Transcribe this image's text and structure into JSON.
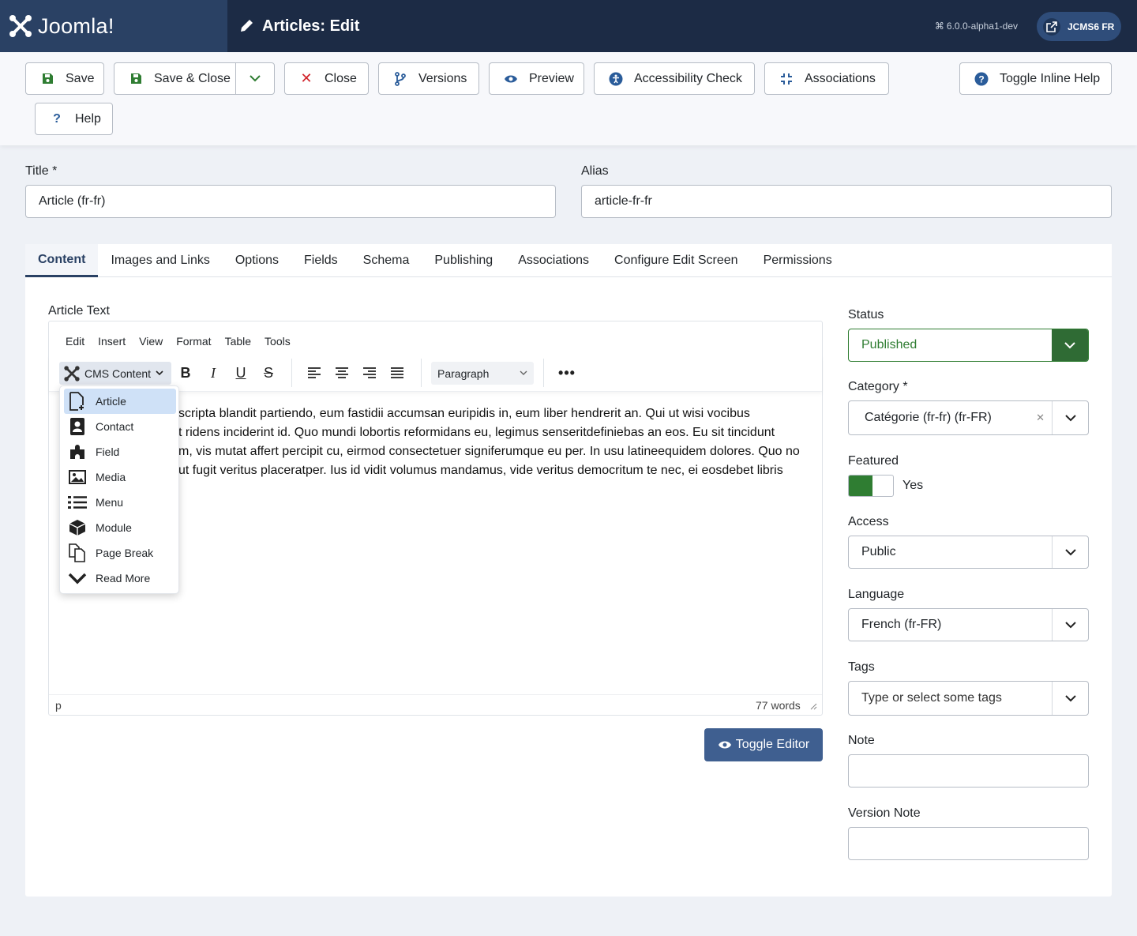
{
  "header": {
    "logo_text": "Joomla!",
    "page_title": "Articles: Edit",
    "version": "6.0.0-alpha1-dev",
    "site_button": "JCMS6 FR"
  },
  "toolbar": {
    "save": "Save",
    "save_close": "Save & Close",
    "close": "Close",
    "versions": "Versions",
    "preview": "Preview",
    "accessibility": "Accessibility Check",
    "associations": "Associations",
    "toggle_help": "Toggle Inline Help",
    "help": "Help"
  },
  "form": {
    "title_label": "Title *",
    "title_value": "Article (fr-fr)",
    "alias_label": "Alias",
    "alias_value": "article-fr-fr"
  },
  "tabs": [
    "Content",
    "Images and Links",
    "Options",
    "Fields",
    "Schema",
    "Publishing",
    "Associations",
    "Configure Edit Screen",
    "Permissions"
  ],
  "editor": {
    "label": "Article Text",
    "menus": [
      "Edit",
      "Insert",
      "View",
      "Format",
      "Table",
      "Tools"
    ],
    "cms_content": "CMS Content",
    "paragraph": "Paragraph",
    "lines": [
      "scripta blandit partiendo, eum fastidii accumsan euripidis in, eum liber hendrerit an. Qui ut wisi vocibus",
      "t ridens inciderint id. Quo mundi lobortis reformidans eu, legimus senseritdefiniebas an eos. Eu sit tincidunt",
      "m, vis mutat affert percipit cu, eirmod consectetuer signiferumque eu per. In usu latineequidem dolores. Quo no",
      "ut fugit veritus placeratper. Ius id vidit volumus mandamus, vide veritus democritum te nec, ei eosdebet libris"
    ],
    "path": "p",
    "word_count": "77 words",
    "toggle_editor": "Toggle Editor"
  },
  "cms_menu": {
    "items": [
      "Article",
      "Contact",
      "Field",
      "Media",
      "Menu",
      "Module",
      "Page Break",
      "Read More"
    ],
    "selected": "Article"
  },
  "sidebar": {
    "status_label": "Status",
    "status_value": "Published",
    "category_label": "Category *",
    "category_value": "Catégorie (fr-fr) (fr-FR)",
    "featured_label": "Featured",
    "featured_value": "Yes",
    "access_label": "Access",
    "access_value": "Public",
    "language_label": "Language",
    "language_value": "French (fr-FR)",
    "tags_label": "Tags",
    "tags_placeholder": "Type or select some tags",
    "note_label": "Note",
    "version_note_label": "Version Note"
  },
  "colors": {
    "header": "#1c2b45",
    "accent": "#2a4164",
    "published": "#2f7d32"
  }
}
